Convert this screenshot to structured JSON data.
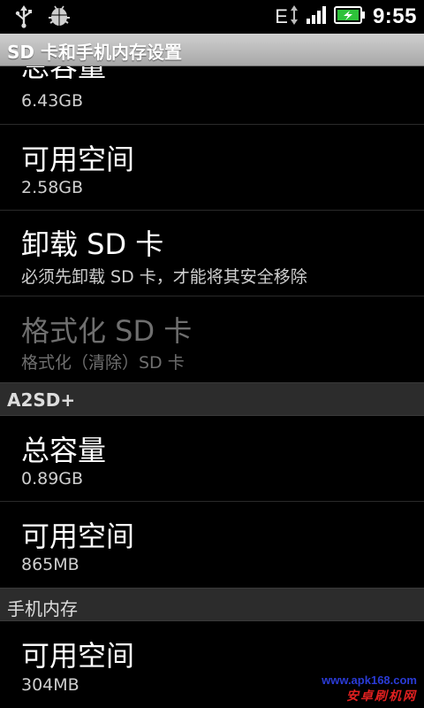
{
  "status_bar": {
    "network": "E",
    "time": "9:55",
    "icons": [
      "usb-icon",
      "android-debug-icon",
      "data-arrows-icon",
      "signal-icon",
      "battery-charging-icon"
    ]
  },
  "title_bar": {
    "title": "SD 卡和手机内存设置"
  },
  "items": [
    {
      "title": "总容量",
      "summary": "6.43GB"
    },
    {
      "title": "可用空间",
      "summary": "2.58GB"
    },
    {
      "title": "卸载 SD 卡",
      "summary": "必须先卸载 SD 卡，才能将其安全移除"
    },
    {
      "title": "格式化 SD 卡",
      "summary": "格式化（清除）SD 卡"
    },
    {
      "title": "总容量",
      "summary": "0.89GB"
    },
    {
      "title": "可用空间",
      "summary": "865MB"
    },
    {
      "title": "可用空间",
      "summary": "304MB"
    }
  ],
  "sections": {
    "a2sd": "A2SD+",
    "phone_storage": "手机内存"
  },
  "watermark": {
    "url": "www.apk168.com",
    "text": "安卓刷机网"
  },
  "colors": {
    "title_bar_bg": "#bdbdbd",
    "section_bg": "#2c2c2c",
    "battery_green": "#2ec23a",
    "disabled_text": "#6f6f6f"
  }
}
